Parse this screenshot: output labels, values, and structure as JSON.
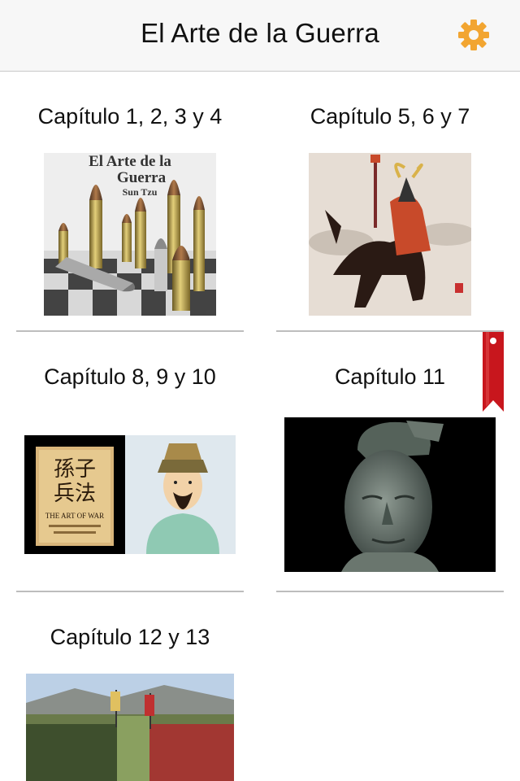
{
  "header": {
    "title": "El Arte de la Guerra",
    "accent": "#f2a531"
  },
  "chapters": [
    {
      "title": "Capítulo 1, 2, 3 y 4",
      "image": "book-cover-bullets-chess"
    },
    {
      "title": "Capítulo 5, 6 y 7",
      "image": "samurai-on-horse"
    },
    {
      "title": "Capítulo 8, 9 y 10",
      "image": "sun-tzu-art-of-war"
    },
    {
      "title": "Capítulo 11",
      "image": "terracotta-warrior",
      "bookmarked": true
    },
    {
      "title": "Capítulo 12 y 13",
      "image": "army-battlefield"
    }
  ],
  "colors": {
    "separator": "#bdbdbd",
    "bookmark": "#c8161d"
  },
  "book_cover": {
    "title_line1": "El Arte de la",
    "title_line2": "Guerra",
    "author": "Sun Tzu"
  },
  "art_of_war_panel": {
    "chinese_top": "孫子",
    "chinese_bottom": "兵法",
    "english": "THE ART OF WAR"
  }
}
